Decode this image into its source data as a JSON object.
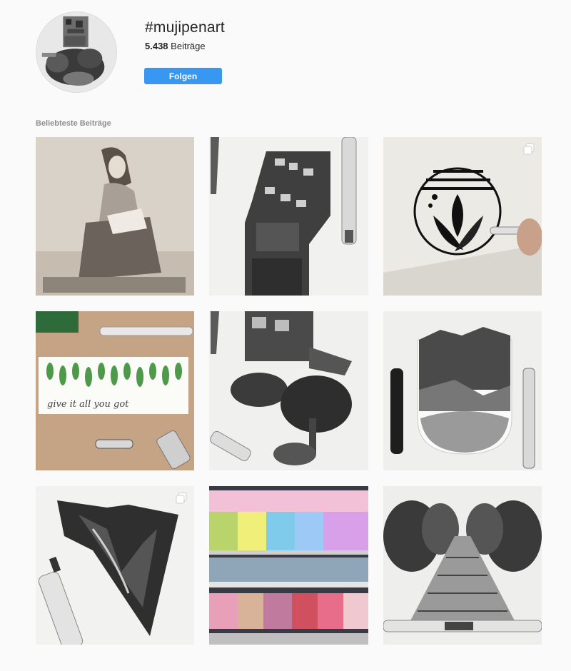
{
  "header": {
    "hashtag": "#mujipenart",
    "post_count": "5.438",
    "post_count_label": "Beiträge",
    "follow_label": "Folgen"
  },
  "section": {
    "title": "Beliebteste Beiträge"
  },
  "posts": [
    {
      "subject": "woman sketch",
      "multi": false
    },
    {
      "subject": "city tower drawing with pen",
      "multi": false
    },
    {
      "subject": "sunrise botanical circle",
      "multi": true
    },
    {
      "subject": "leaves watercolor lettering",
      "multi": false,
      "caption": "give it all you got"
    },
    {
      "subject": "houses and bonsai drawing",
      "multi": false
    },
    {
      "subject": "mountain lake arch drawing",
      "multi": false
    },
    {
      "subject": "mountain valley heart drawing",
      "multi": true
    },
    {
      "subject": "gel pens store shelf",
      "multi": false
    },
    {
      "subject": "forest bridge drawing",
      "multi": false
    }
  ],
  "colors": {
    "follow_button": "#3897f0",
    "background": "#fafafa",
    "muted_text": "#8e8e8e"
  }
}
